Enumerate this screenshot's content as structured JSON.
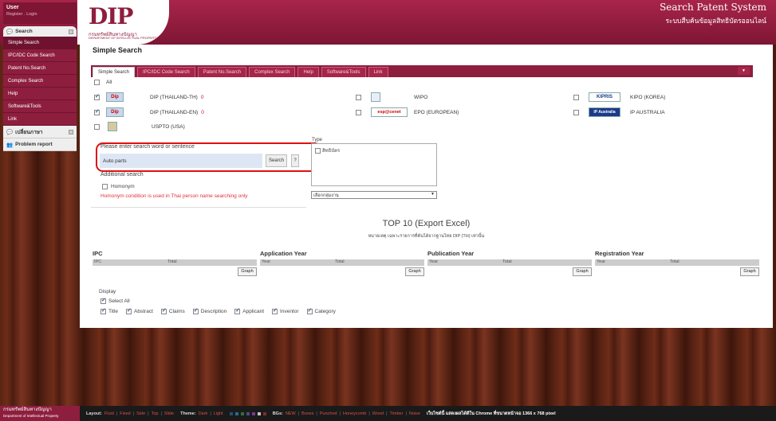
{
  "header": {
    "logo_text": "DIP",
    "logo_thai": "กรมทรัพย์สินทางปัญญา",
    "logo_en": "DEPARTMENT OF INTELLECTUAL PROPERTY",
    "title": "Search Patent System",
    "subtitle": "ระบบสืบค้นข้อมูลสิทธิบัตรออนไลน์"
  },
  "user": {
    "name": "User",
    "links": "Register . Login"
  },
  "sidebar": {
    "section_label": "Search",
    "items": [
      {
        "label": "Simple Search"
      },
      {
        "label": "IPC/IDC Code Search"
      },
      {
        "label": "Patent No.Search"
      },
      {
        "label": "Complex Search"
      },
      {
        "label": "Help"
      },
      {
        "label": "Software&Tools"
      },
      {
        "label": "Link"
      }
    ],
    "language_label": "เปลี่ยนภาษา",
    "problem_label": "Problem report"
  },
  "page_title": "Simple Search",
  "tabs": [
    {
      "label": "Simple Search"
    },
    {
      "label": "IPC/IDC Code Search"
    },
    {
      "label": "Patent No.Search"
    },
    {
      "label": "Complex Search"
    },
    {
      "label": "Help"
    },
    {
      "label": "Software&Tools"
    },
    {
      "label": "Link"
    }
  ],
  "databases": {
    "all_label": "All",
    "dip_th": {
      "label": "DIP (THAILAND-TH)",
      "count": "0"
    },
    "dip_en": {
      "label": "DIP (THAILAND-EN)",
      "count": "0"
    },
    "uspto": {
      "label": "USPTO (USA)"
    },
    "wipo": {
      "label": "WIPO"
    },
    "epo": {
      "label": "EPO (EUROPEAN)",
      "logo": "esp@cenet"
    },
    "kipo": {
      "label": "KIPO (KOREA)",
      "logo": "KIPRIS"
    },
    "ip_au": {
      "label": "IP AUSTRALIA",
      "logo": "IP Australia"
    }
  },
  "search": {
    "label": "Please enter search word or sentence",
    "value": "Auto parts",
    "button": "Search",
    "help": "?",
    "additional_label": "Additional search",
    "homonym_label": "Homonym",
    "homonym_note": "Homonym condition is used in Thai person name searching only"
  },
  "type_filter": {
    "label": "Type",
    "option": "สิทธิบัตร",
    "select_value": "เลือกกลุ่มงาน"
  },
  "top10": {
    "title": "TOP 10 (Export Excel)",
    "note": "หมายเหตุ เฉพาะรายการที่ค้นได้จากฐานไทย DIP (TH) เท่านั้น",
    "graph_label": "Graph",
    "stats": [
      {
        "title": "IPC",
        "col1": "IPC",
        "col2": "Total"
      },
      {
        "title": "Application Year",
        "col1": "Year",
        "col2": "Total"
      },
      {
        "title": "Publication Year",
        "col1": "Year",
        "col2": "Total"
      },
      {
        "title": "Registration Year",
        "col1": "Year",
        "col2": "Total"
      }
    ]
  },
  "display": {
    "label": "Display",
    "select_all": "Select All",
    "fields": [
      "Title",
      "Abstract",
      "Claims",
      "Description",
      "Applicant",
      "Inventor",
      "Category"
    ]
  },
  "bottom_bar": {
    "logo_thai": "กรมทรัพย์สินทางปัญญา",
    "logo_en": "Department of Intellectual Property",
    "layout_key": "Layout:",
    "layout_options": [
      "Fluid",
      "Fixed",
      "Side",
      "Top",
      "Slide"
    ],
    "theme_key": "Theme:",
    "theme_options": [
      "Dark",
      "Light"
    ],
    "bgs_key": "BGs:",
    "bg_options": [
      "NEW",
      "Boxes",
      "Punched",
      "Honeycomb",
      "Wood",
      "Timber",
      "Noise"
    ],
    "note": "เว็บไซต์นี้ แสดงผลได้ดีใน Chrome ที่ขนาดหน้าจอ 1366 x 768 pixel",
    "swatches": [
      "#2a4a7a",
      "#2a6a8a",
      "#3a6a3a",
      "#4a4a8a",
      "#7a3a8a",
      "#c0c0c0",
      "#8a2a2a"
    ]
  },
  "colors": {
    "brand": "#8e1e3e",
    "accent_red": "#e01010"
  }
}
